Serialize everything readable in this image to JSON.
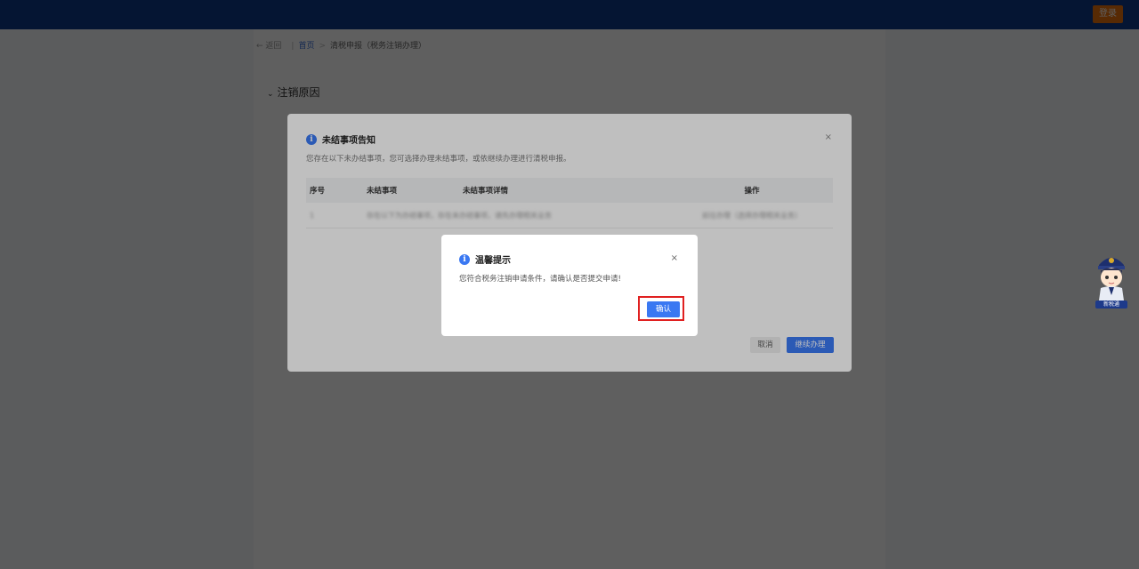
{
  "header": {
    "login_label": "登录"
  },
  "breadcrumb": {
    "back": "← 返回",
    "home": "首页",
    "current": "清税申报（税务注销办理）"
  },
  "section": {
    "title": "注销原因"
  },
  "notice_dialog": {
    "title": "未结事项告知",
    "description": "您存在以下未办结事项，您可选择办理未结事项，或依继续办理进行清税申报。",
    "table": {
      "headers": [
        "序号",
        "未结事项",
        "未结事项详情",
        "操作"
      ],
      "rows": [
        {
          "index": "1",
          "item": "存在以下为办结事项",
          "detail": "存在未办结事项，请先办理相关业务",
          "action": "前往办理（选择办理相关业务）"
        }
      ]
    },
    "cancel_label": "取消",
    "continue_label": "继续办理"
  },
  "tip_dialog": {
    "title": "温馨提示",
    "message": "您符合税务注销申请条件，请确认是否提交申请!",
    "confirm_label": "确认"
  },
  "mascot": {
    "caption": "新税通"
  },
  "colors": {
    "primary": "#3a78f2",
    "topbar": "#0f3a8a",
    "login": "#e8730c",
    "highlight": "#e02020"
  },
  "icons": {
    "info": "info-circle-icon",
    "close": "close-icon"
  }
}
